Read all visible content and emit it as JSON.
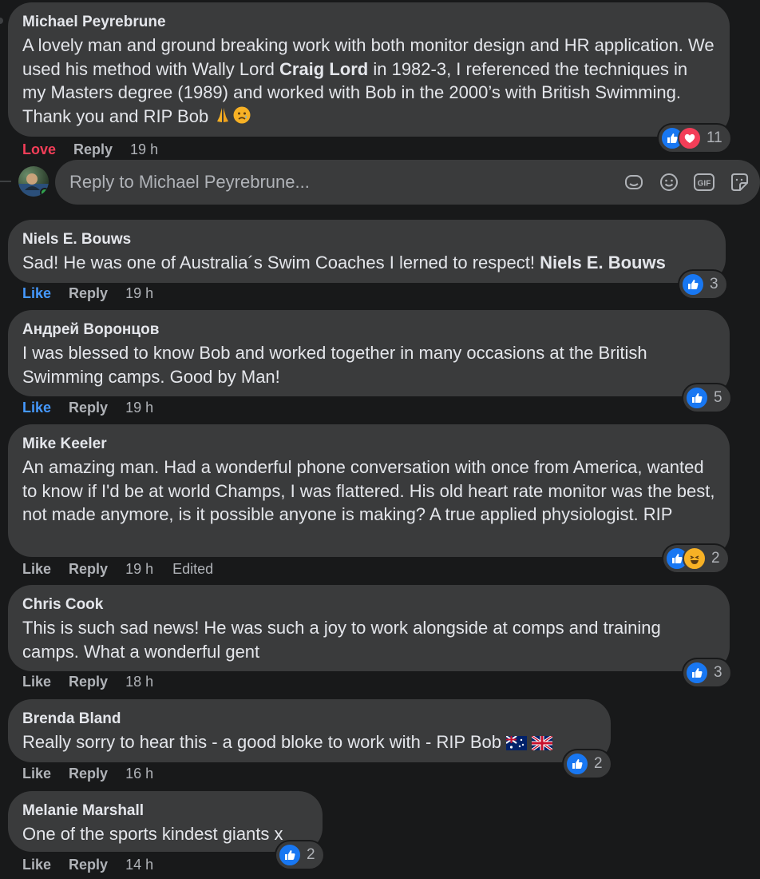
{
  "reply_box": {
    "placeholder": "Reply to Michael Peyrebrune..."
  },
  "comments": [
    {
      "author": "Michael Peyrebrune",
      "text_parts": [
        "A lovely man and ground breaking work with both monitor design and HR application. We used his method with Wally Lord ",
        "Craig Lord",
        " in 1982-3, I referenced the techniques in my Masters degree (1989) and worked with Bob in the 2000’s with British Swimming. Thank you and RIP Bob"
      ],
      "emoji_suffix": [
        "folded-hands-emoji",
        "sad-relieved-face-emoji"
      ],
      "actions": {
        "reaction": "Love",
        "reply": "Reply",
        "time": "19 h"
      },
      "reactions": {
        "icons": [
          "like",
          "love"
        ],
        "count": "11"
      }
    },
    {
      "author": "Niels E. Bouws",
      "text_parts": [
        "Sad! He was one of Australia´s Swim Coaches I lerned to respect! ",
        "Niels E. Bouws"
      ],
      "actions": {
        "reaction": "Like",
        "reply": "Reply",
        "time": "19 h"
      },
      "reactions": {
        "icons": [
          "like"
        ],
        "count": "3"
      }
    },
    {
      "author": "Андрей Воронцов",
      "text": "I was blessed to know Bob and worked together in many occasions at the British Swimming camps. Good by Man!",
      "actions": {
        "reaction": "Like",
        "reply": "Reply",
        "time": "19 h"
      },
      "reactions": {
        "icons": [
          "like"
        ],
        "count": "5"
      }
    },
    {
      "author": "Mike Keeler",
      "text": "An amazing man. Had a wonderful phone conversation with once from America, wanted to know if I'd be at world Champs, I was flattered. His old heart rate monitor was the best, not made anymore, is it possible anyone is making? A true applied physiologist. RIP",
      "actions": {
        "reaction": "Like",
        "reply": "Reply",
        "time": "19 h",
        "edited": "Edited"
      },
      "reactions": {
        "icons": [
          "like",
          "haha"
        ],
        "count": "2"
      }
    },
    {
      "author": "Chris Cook",
      "text": "This is such sad news! He was such a joy to work alongside at comps and training camps. What a wonderful gent",
      "actions": {
        "reaction": "Like",
        "reply": "Reply",
        "time": "18 h"
      },
      "reactions": {
        "icons": [
          "like"
        ],
        "count": "3"
      }
    },
    {
      "author": "Brenda Bland",
      "text": "Really sorry to hear this - a good bloke to work with - RIP Bob",
      "emoji_suffix": [
        "australia-flag-emoji",
        "uk-flag-emoji"
      ],
      "actions": {
        "reaction": "Like",
        "reply": "Reply",
        "time": "16 h"
      },
      "reactions": {
        "icons": [
          "like"
        ],
        "count": "2"
      }
    },
    {
      "author": "Melanie Marshall",
      "text": "One of the sports kindest giants x",
      "actions": {
        "reaction": "Like",
        "reply": "Reply",
        "time": "14 h"
      },
      "reactions": {
        "icons": [
          "like"
        ],
        "count": "2"
      }
    }
  ],
  "colors": {
    "background": "#18191a",
    "bubble": "#3a3b3c",
    "text": "#e4e6eb",
    "muted": "#b0b3b8",
    "like_blue": "#1877f2",
    "love_red": "#f33e58"
  }
}
